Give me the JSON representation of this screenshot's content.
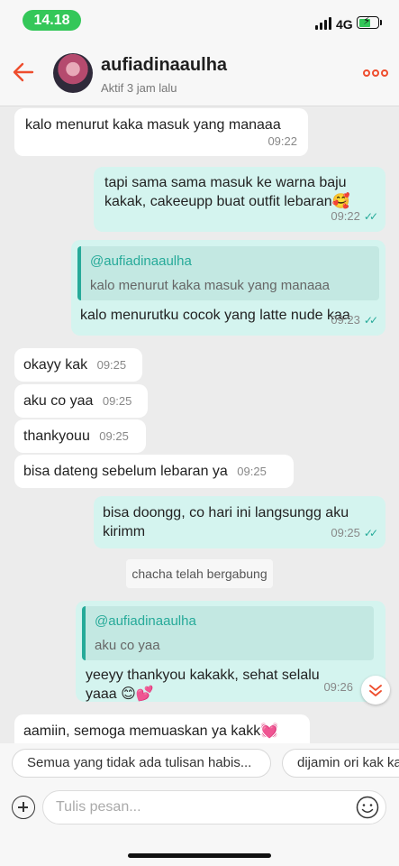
{
  "status_bar": {
    "time": "14.18",
    "network": "4G",
    "battery_percent": 60
  },
  "header": {
    "contact_name": "aufiadinaaulha",
    "contact_status": "Aktif 3 jam lalu"
  },
  "messages": [
    {
      "text": "kalo menurut kaka masuk yang manaaa",
      "time": "09:22"
    },
    {
      "text": "tapi sama sama masuk ke warna baju kakak, cakeeupp buat outfit lebaran🥰",
      "time": "09:22"
    },
    {
      "quote_name": "@aufiadinaaulha",
      "quote_text": "kalo menurut kaka masuk yang manaaa",
      "text": "kalo menurutku cocok yang latte nude kaa",
      "time": "09:23"
    },
    {
      "text": "okayy kak",
      "time": "09:25"
    },
    {
      "text": "aku co yaa",
      "time": "09:25"
    },
    {
      "text": "thankyouu",
      "time": "09:25"
    },
    {
      "text": "bisa dateng sebelum lebaran ya",
      "time": "09:25"
    },
    {
      "text": "bisa doongg, co hari ini langsungg aku kirimm",
      "time": "09:25"
    },
    {
      "quote_name": "@aufiadinaaulha",
      "quote_text": "aku co yaa",
      "text": "yeeyy thankyou kakakk, sehat selalu yaaa 😊💕",
      "time": "09:26"
    },
    {
      "text": "aamiin, semoga memuaskan ya kakk💓",
      "time": ""
    }
  ],
  "system_notice": "chacha telah bergabung",
  "quick_replies": [
    "Semua yang tidak ada tulisan habis...",
    "dijamin ori kak ka"
  ],
  "input": {
    "placeholder": "Tulis pesan..."
  },
  "colors": {
    "accent": "#ee4d2d",
    "outgoing_bubble": "#d4f4ef",
    "teal": "#26aa99",
    "online_pill": "#34c759"
  },
  "icons": [
    "back-arrow-icon",
    "more-dots-icon",
    "plus-icon",
    "emoji-icon",
    "chevron-down-icon",
    "double-check-icon"
  ]
}
